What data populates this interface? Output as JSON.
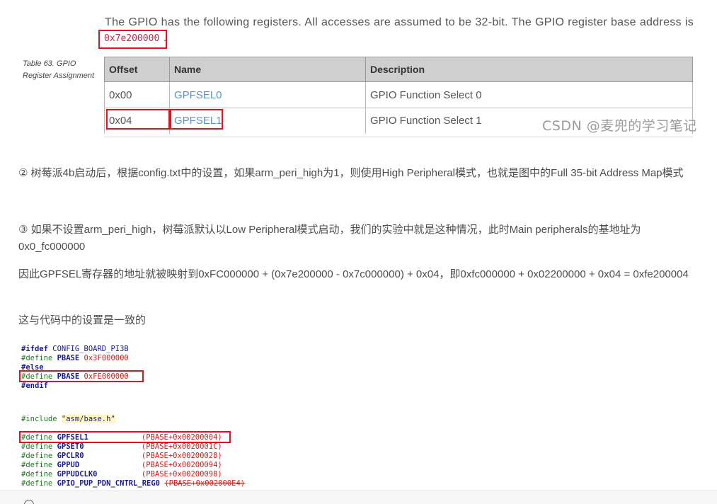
{
  "doc": {
    "intro_text": "The GPIO has the following registers. All accesses are assumed to be 32-bit. The GPIO register base address is",
    "base_address": "0x7e200000",
    "base_address_suffix": ".",
    "table_caption": "Table 63. GPIO Register Assignment",
    "table": {
      "headers": [
        "Offset",
        "Name",
        "Description"
      ],
      "rows": [
        {
          "offset": "0x00",
          "name": "GPFSEL0",
          "description": "GPIO Function Select 0"
        },
        {
          "offset": "0x04",
          "name": "GPFSEL1",
          "description": "GPIO Function Select 1"
        }
      ]
    },
    "watermark": "CSDN @麦兜的学习笔记",
    "paragraphs": [
      "② 树莓派4b启动后，根据config.txt中的设置，如果arm_peri_high为1，则使用High Peripheral模式，也就是图中的Full 35-bit Address Map模式",
      "③ 如果不设置arm_peri_high，树莓派默认以Low Peripheral模式启动，我们的实验中就是这种情况，此时Main peripherals的基地址为0x0_fc000000",
      "因此GPFSEL寄存器的地址就被映射到0xFC000000 + (0x7e200000 - 0x7c000000) + 0x04，即0xfc000000 + 0x02200000 + 0x04 = 0xfe200004",
      "这与代码中的设置是一致的"
    ]
  },
  "code": {
    "ifdef": "#ifdef",
    "ifdef_arg": " CONFIG_BOARD_PI3B",
    "define": "#define",
    "else": "#else",
    "endif": "#endif",
    "include": "#include",
    "include_arg": "\"asm/base.h\"",
    "pbase_name": "PBASE",
    "pbase_pi3": "0x3F000000",
    "pbase_pi4": "0xFE000000",
    "defines": [
      {
        "name": "GPFSEL1",
        "value": "(PBASE+0x00200004)"
      },
      {
        "name": "GPSET0",
        "value": "(PBASE+0x0020001C)"
      },
      {
        "name": "GPCLR0",
        "value": "(PBASE+0x00200028)"
      },
      {
        "name": "GPPUD",
        "value": "(PBASE+0x00200094)"
      },
      {
        "name": "GPPUDCLK0",
        "value": "(PBASE+0x00200098)"
      },
      {
        "name": "GPIO_PUP_PDN_CNTRL_REG0",
        "value": "(PBASE+0x002000E4)"
      }
    ]
  },
  "colors": {
    "highlight_box": "#e0121f",
    "link": "#5a93c9",
    "code_number": "#d11b1b",
    "code_define": "#1f7a1f"
  }
}
